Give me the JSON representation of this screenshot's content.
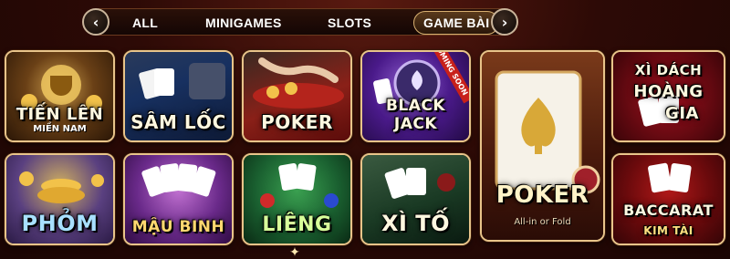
{
  "nav": {
    "prev_glyph": "‹",
    "next_glyph": "›",
    "tabs": [
      {
        "label": "ALL",
        "active": false
      },
      {
        "label": "MINIGAMES",
        "active": false
      },
      {
        "label": "SLOTS",
        "active": false
      },
      {
        "label": "GAME BÀI",
        "active": true
      }
    ]
  },
  "games": [
    {
      "title": "TIẾN LÊN",
      "subtitle": "MIỀN NAM"
    },
    {
      "title": "SÂM LỐC"
    },
    {
      "title": "POKER"
    },
    {
      "title": "BLACK JACK",
      "badge": "COMING SOON"
    },
    {
      "title": "POKER",
      "subtitle": "All-in or Fold"
    },
    {
      "title_lines": [
        "XÌ DÁCH",
        "HOÀNG",
        "GIA"
      ]
    },
    {
      "title": "PHỎM"
    },
    {
      "title": "MẬU BINH"
    },
    {
      "title": "LIÊNG"
    },
    {
      "title": "XÌ TỐ"
    },
    {
      "title_lines": [
        "BACCARAT",
        "KIM TÀI"
      ]
    }
  ],
  "colors": {
    "tile_border": "#e8c48a",
    "title_text": "#fff8e0",
    "badge": "#c8201a"
  },
  "icons": {
    "prev": "chevron-left-icon",
    "next": "chevron-right-icon",
    "footer": "sparkle-icon"
  }
}
